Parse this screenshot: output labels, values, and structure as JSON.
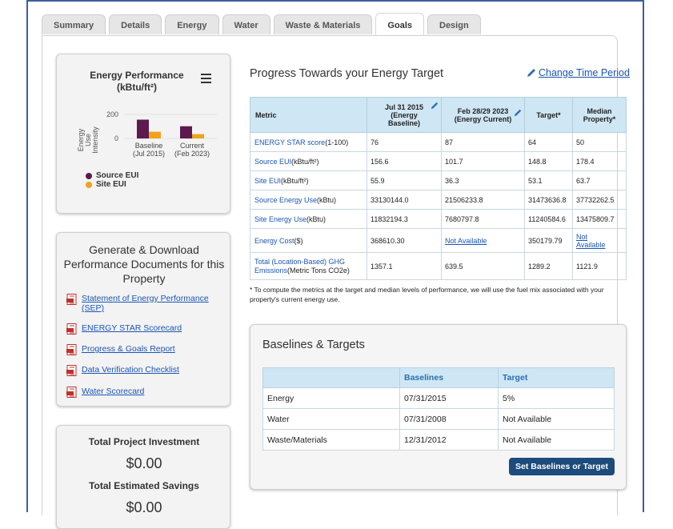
{
  "tabs": [
    {
      "label": "Summary",
      "active": false
    },
    {
      "label": "Details",
      "active": false
    },
    {
      "label": "Energy",
      "active": false
    },
    {
      "label": "Water",
      "active": false
    },
    {
      "label": "Waste & Materials",
      "active": false
    },
    {
      "label": "Goals",
      "active": true
    },
    {
      "label": "Design",
      "active": false
    }
  ],
  "perf_card": {
    "title_line1": "Energy Performance",
    "title_line2": "(kBtu/ft²)",
    "ylabel_lines": [
      "Energy",
      "Use",
      "Intensity"
    ],
    "legend": [
      {
        "label": "Source EUI",
        "color": "#5c1a4f"
      },
      {
        "label": "Site EUI",
        "color": "#f0a31c"
      }
    ]
  },
  "chart_data": {
    "type": "bar",
    "title": "Energy Performance (kBtu/ft²)",
    "ylabel": "Energy Use Intensity",
    "categories": [
      [
        "Baseline",
        "(Jul 2015)"
      ],
      [
        "Current",
        "(Feb 2023)"
      ]
    ],
    "yticks": [
      0,
      200
    ],
    "ylim": [
      0,
      300
    ],
    "series": [
      {
        "name": "Source EUI",
        "color": "#5c1a4f",
        "values": [
          156.6,
          101.7
        ]
      },
      {
        "name": "Site EUI",
        "color": "#f0a31c",
        "values": [
          55.9,
          36.3
        ]
      }
    ]
  },
  "docs_card": {
    "title": "Generate & Download Performance Documents for this Property",
    "links": [
      "Statement of Energy Performance (SEP)",
      "ENERGY STAR Scorecard",
      "Progress & Goals Report",
      "Data Verification Checklist",
      "Water Scorecard"
    ]
  },
  "invest_card": {
    "investment_label": "Total Project Investment",
    "investment_value": "$0.00",
    "savings_label": "Total Estimated Savings",
    "savings_value": "$0.00"
  },
  "progress": {
    "title": "Progress Towards your Energy Target",
    "change_link": "Change Time Period",
    "headers": {
      "metric": "Metric",
      "baseline": [
        "Jul 31 2015",
        "(Energy",
        "Baseline)"
      ],
      "current": [
        "Feb 28/29 2023",
        "(Energy Current)"
      ],
      "target": "Target*",
      "median": [
        "Median",
        "Property*"
      ]
    },
    "rows": [
      {
        "name": "ENERGY STAR score",
        "unit": "(1-100)",
        "baseline": "76",
        "current": "87",
        "target": "64",
        "median": "50"
      },
      {
        "name": "Source EUI",
        "unit": "(kBtu/ft²)",
        "baseline": "156.6",
        "current": "101.7",
        "target": "148.8",
        "median": "178.4"
      },
      {
        "name": "Site EUI",
        "unit": "(kBtu/ft²)",
        "baseline": "55.9",
        "current": "36.3",
        "target": "53.1",
        "median": "63.7"
      },
      {
        "name": "Source Energy Use",
        "unit": "(kBtu)",
        "baseline": "33130144.0",
        "current": "21506233.8",
        "target": "31473636.8",
        "median": "37732262.5"
      },
      {
        "name": "Site Energy Use",
        "unit": "(kBtu)",
        "baseline": "11832194.3",
        "current": "7680797.8",
        "target": "11240584.6",
        "median": "13475809.7"
      },
      {
        "name": "Energy Cost",
        "unit": "($)",
        "baseline": "368610.30",
        "current": "Not Available",
        "target": "350179.79",
        "median": "Not Available"
      },
      {
        "name": "Total (Location-Based) GHG Emissions",
        "unit": "(Metric Tons CO2e)",
        "baseline": "1357.1",
        "current": "639.5",
        "target": "1289.2",
        "median": "1121.9"
      }
    ],
    "footnote": "* To compute the metrics at the target and median levels of performance, we will use the fuel mix associated with your property's current energy use."
  },
  "baselines": {
    "title": "Baselines & Targets",
    "headers": [
      "",
      "Baselines",
      "Target"
    ],
    "rows": [
      [
        "Energy",
        "07/31/2015",
        "5%"
      ],
      [
        "Water",
        "07/31/2008",
        "Not Available"
      ],
      [
        "Waste/Materials",
        "12/31/2012",
        "Not Available"
      ]
    ],
    "button": "Set Baselines or Target"
  }
}
